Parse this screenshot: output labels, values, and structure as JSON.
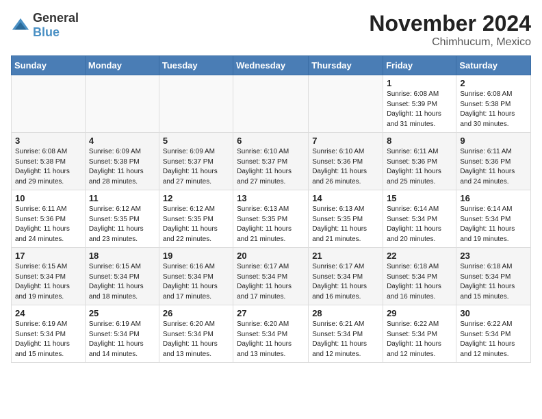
{
  "header": {
    "logo_general": "General",
    "logo_blue": "Blue",
    "month": "November 2024",
    "location": "Chimhucum, Mexico"
  },
  "weekdays": [
    "Sunday",
    "Monday",
    "Tuesday",
    "Wednesday",
    "Thursday",
    "Friday",
    "Saturday"
  ],
  "weeks": [
    [
      {
        "day": "",
        "info": ""
      },
      {
        "day": "",
        "info": ""
      },
      {
        "day": "",
        "info": ""
      },
      {
        "day": "",
        "info": ""
      },
      {
        "day": "",
        "info": ""
      },
      {
        "day": "1",
        "info": "Sunrise: 6:08 AM\nSunset: 5:39 PM\nDaylight: 11 hours and 31 minutes."
      },
      {
        "day": "2",
        "info": "Sunrise: 6:08 AM\nSunset: 5:38 PM\nDaylight: 11 hours and 30 minutes."
      }
    ],
    [
      {
        "day": "3",
        "info": "Sunrise: 6:08 AM\nSunset: 5:38 PM\nDaylight: 11 hours and 29 minutes."
      },
      {
        "day": "4",
        "info": "Sunrise: 6:09 AM\nSunset: 5:38 PM\nDaylight: 11 hours and 28 minutes."
      },
      {
        "day": "5",
        "info": "Sunrise: 6:09 AM\nSunset: 5:37 PM\nDaylight: 11 hours and 27 minutes."
      },
      {
        "day": "6",
        "info": "Sunrise: 6:10 AM\nSunset: 5:37 PM\nDaylight: 11 hours and 27 minutes."
      },
      {
        "day": "7",
        "info": "Sunrise: 6:10 AM\nSunset: 5:36 PM\nDaylight: 11 hours and 26 minutes."
      },
      {
        "day": "8",
        "info": "Sunrise: 6:11 AM\nSunset: 5:36 PM\nDaylight: 11 hours and 25 minutes."
      },
      {
        "day": "9",
        "info": "Sunrise: 6:11 AM\nSunset: 5:36 PM\nDaylight: 11 hours and 24 minutes."
      }
    ],
    [
      {
        "day": "10",
        "info": "Sunrise: 6:11 AM\nSunset: 5:36 PM\nDaylight: 11 hours and 24 minutes."
      },
      {
        "day": "11",
        "info": "Sunrise: 6:12 AM\nSunset: 5:35 PM\nDaylight: 11 hours and 23 minutes."
      },
      {
        "day": "12",
        "info": "Sunrise: 6:12 AM\nSunset: 5:35 PM\nDaylight: 11 hours and 22 minutes."
      },
      {
        "day": "13",
        "info": "Sunrise: 6:13 AM\nSunset: 5:35 PM\nDaylight: 11 hours and 21 minutes."
      },
      {
        "day": "14",
        "info": "Sunrise: 6:13 AM\nSunset: 5:35 PM\nDaylight: 11 hours and 21 minutes."
      },
      {
        "day": "15",
        "info": "Sunrise: 6:14 AM\nSunset: 5:34 PM\nDaylight: 11 hours and 20 minutes."
      },
      {
        "day": "16",
        "info": "Sunrise: 6:14 AM\nSunset: 5:34 PM\nDaylight: 11 hours and 19 minutes."
      }
    ],
    [
      {
        "day": "17",
        "info": "Sunrise: 6:15 AM\nSunset: 5:34 PM\nDaylight: 11 hours and 19 minutes."
      },
      {
        "day": "18",
        "info": "Sunrise: 6:15 AM\nSunset: 5:34 PM\nDaylight: 11 hours and 18 minutes."
      },
      {
        "day": "19",
        "info": "Sunrise: 6:16 AM\nSunset: 5:34 PM\nDaylight: 11 hours and 17 minutes."
      },
      {
        "day": "20",
        "info": "Sunrise: 6:17 AM\nSunset: 5:34 PM\nDaylight: 11 hours and 17 minutes."
      },
      {
        "day": "21",
        "info": "Sunrise: 6:17 AM\nSunset: 5:34 PM\nDaylight: 11 hours and 16 minutes."
      },
      {
        "day": "22",
        "info": "Sunrise: 6:18 AM\nSunset: 5:34 PM\nDaylight: 11 hours and 16 minutes."
      },
      {
        "day": "23",
        "info": "Sunrise: 6:18 AM\nSunset: 5:34 PM\nDaylight: 11 hours and 15 minutes."
      }
    ],
    [
      {
        "day": "24",
        "info": "Sunrise: 6:19 AM\nSunset: 5:34 PM\nDaylight: 11 hours and 15 minutes."
      },
      {
        "day": "25",
        "info": "Sunrise: 6:19 AM\nSunset: 5:34 PM\nDaylight: 11 hours and 14 minutes."
      },
      {
        "day": "26",
        "info": "Sunrise: 6:20 AM\nSunset: 5:34 PM\nDaylight: 11 hours and 13 minutes."
      },
      {
        "day": "27",
        "info": "Sunrise: 6:20 AM\nSunset: 5:34 PM\nDaylight: 11 hours and 13 minutes."
      },
      {
        "day": "28",
        "info": "Sunrise: 6:21 AM\nSunset: 5:34 PM\nDaylight: 11 hours and 12 minutes."
      },
      {
        "day": "29",
        "info": "Sunrise: 6:22 AM\nSunset: 5:34 PM\nDaylight: 11 hours and 12 minutes."
      },
      {
        "day": "30",
        "info": "Sunrise: 6:22 AM\nSunset: 5:34 PM\nDaylight: 11 hours and 12 minutes."
      }
    ]
  ]
}
